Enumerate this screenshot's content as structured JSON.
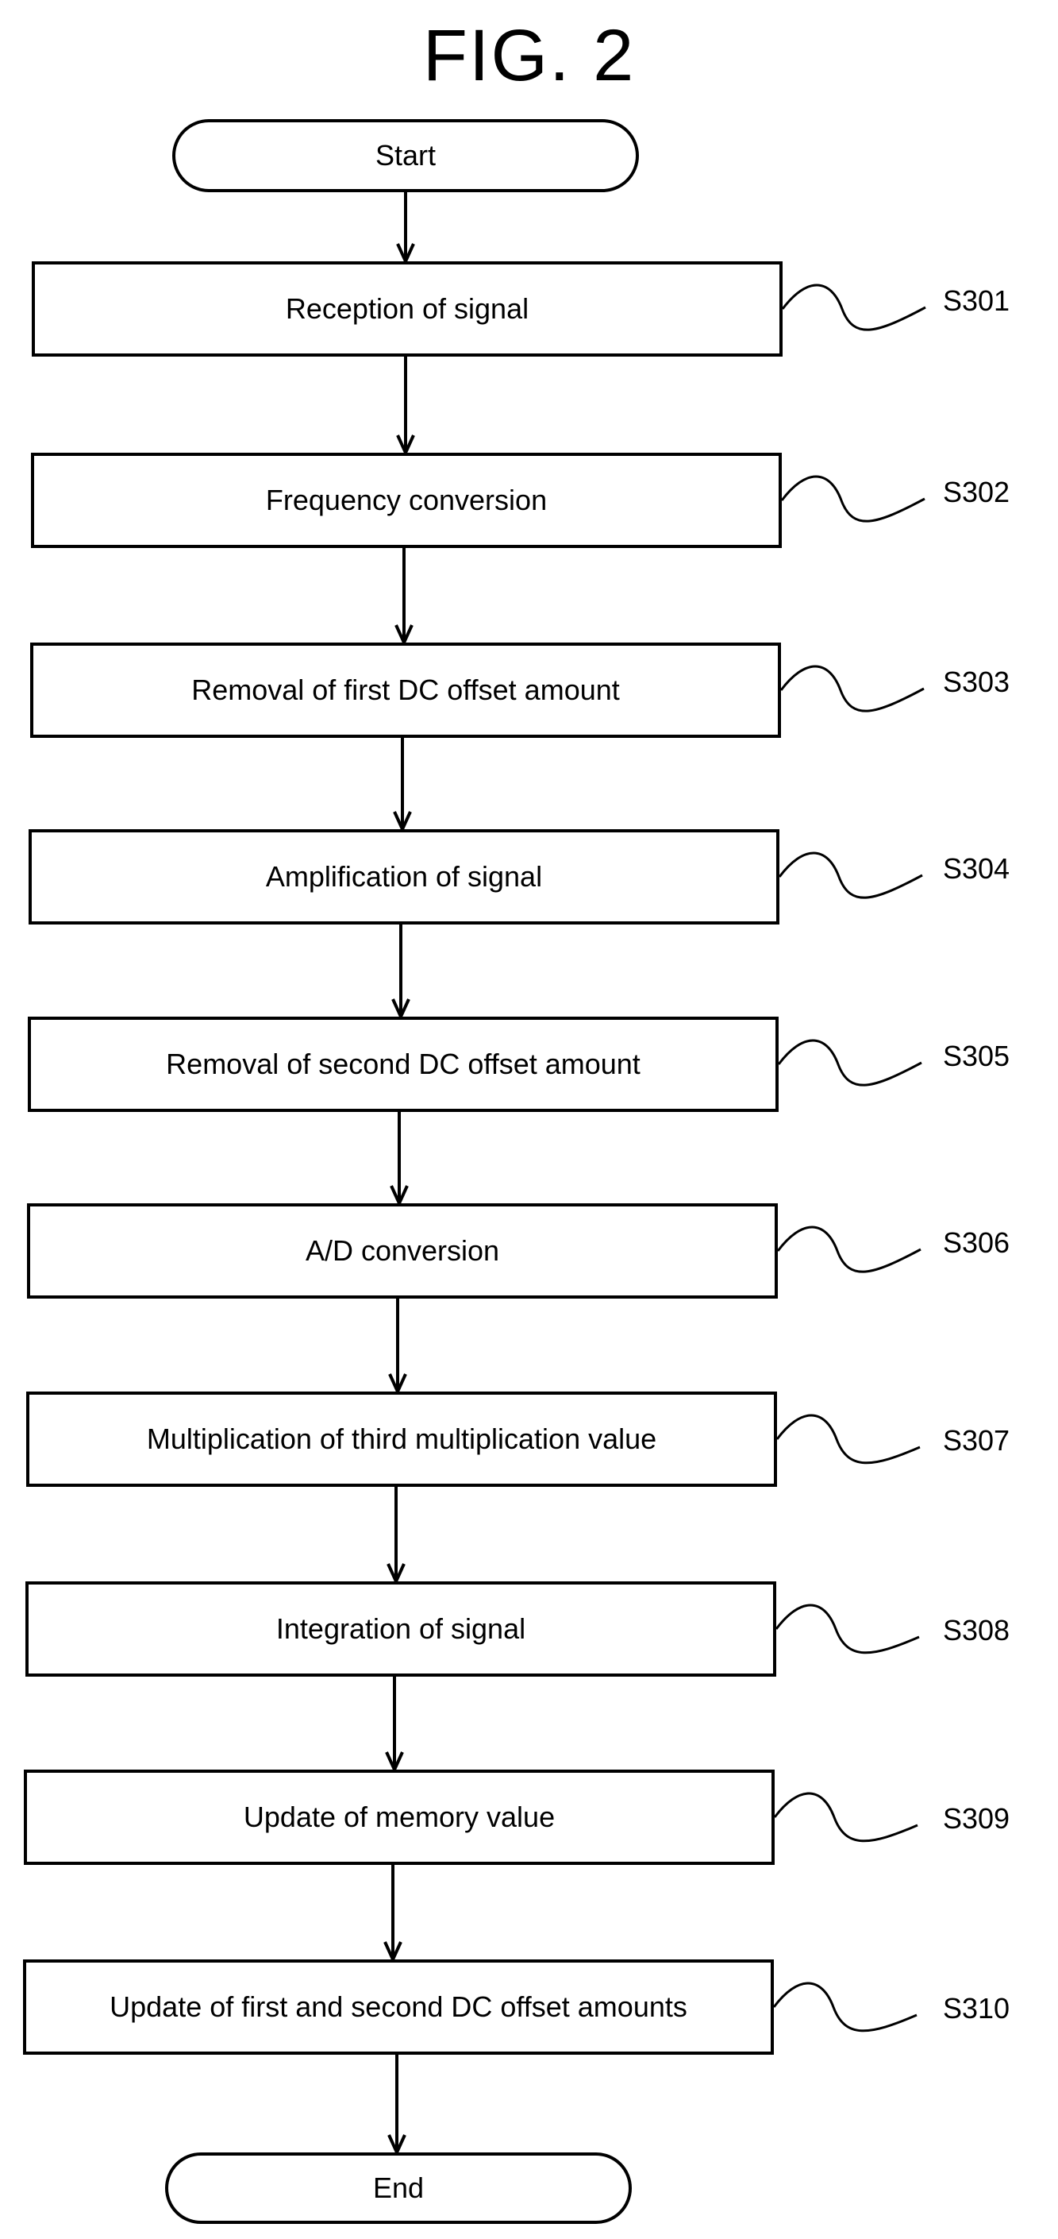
{
  "figure": {
    "title": "FIG.  2"
  },
  "start": {
    "label": "Start"
  },
  "end": {
    "label": "End"
  },
  "steps": [
    {
      "id": "S301",
      "text": "Reception of signal"
    },
    {
      "id": "S302",
      "text": "Frequency conversion"
    },
    {
      "id": "S303",
      "text": "Removal of first DC offset amount"
    },
    {
      "id": "S304",
      "text": "Amplification of signal"
    },
    {
      "id": "S305",
      "text": "Removal of second DC offset amount"
    },
    {
      "id": "S306",
      "text": "A/D conversion"
    },
    {
      "id": "S307",
      "text": "Multiplication of third multiplication value"
    },
    {
      "id": "S308",
      "text": "Integration of signal"
    },
    {
      "id": "S309",
      "text": "Update of memory value"
    },
    {
      "id": "S310",
      "text": "Update of first and second DC offset amounts"
    }
  ],
  "colors": {
    "stroke": "#000000",
    "background": "#ffffff"
  }
}
